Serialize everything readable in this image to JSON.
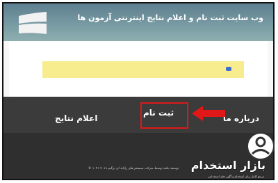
{
  "header": {
    "title": "وب سایت ثبت نام و اعلام نتایج اینترنتی آزمون ها",
    "logo_icon": "windows-logo-icon"
  },
  "notice": {
    "icon": "info-icon",
    "background": "#f7ec8e"
  },
  "nav": {
    "about_label": "درباره ما",
    "register_label": "ثبت نام",
    "results_label": "اعلام نتایج"
  },
  "annotation": {
    "arrow_icon": "red-arrow-icon",
    "color": "#e01818"
  },
  "footer": {
    "credit": "توسعه یافته توسط شرکت سیستم های رایانه ای ترگیم ۲۰۱۸-۱۰۴۱ ©"
  },
  "watermark": {
    "brand": "بازار استخدام",
    "tagline": "مرجع کامل برای استخدام و آگهی های استخدامی"
  }
}
